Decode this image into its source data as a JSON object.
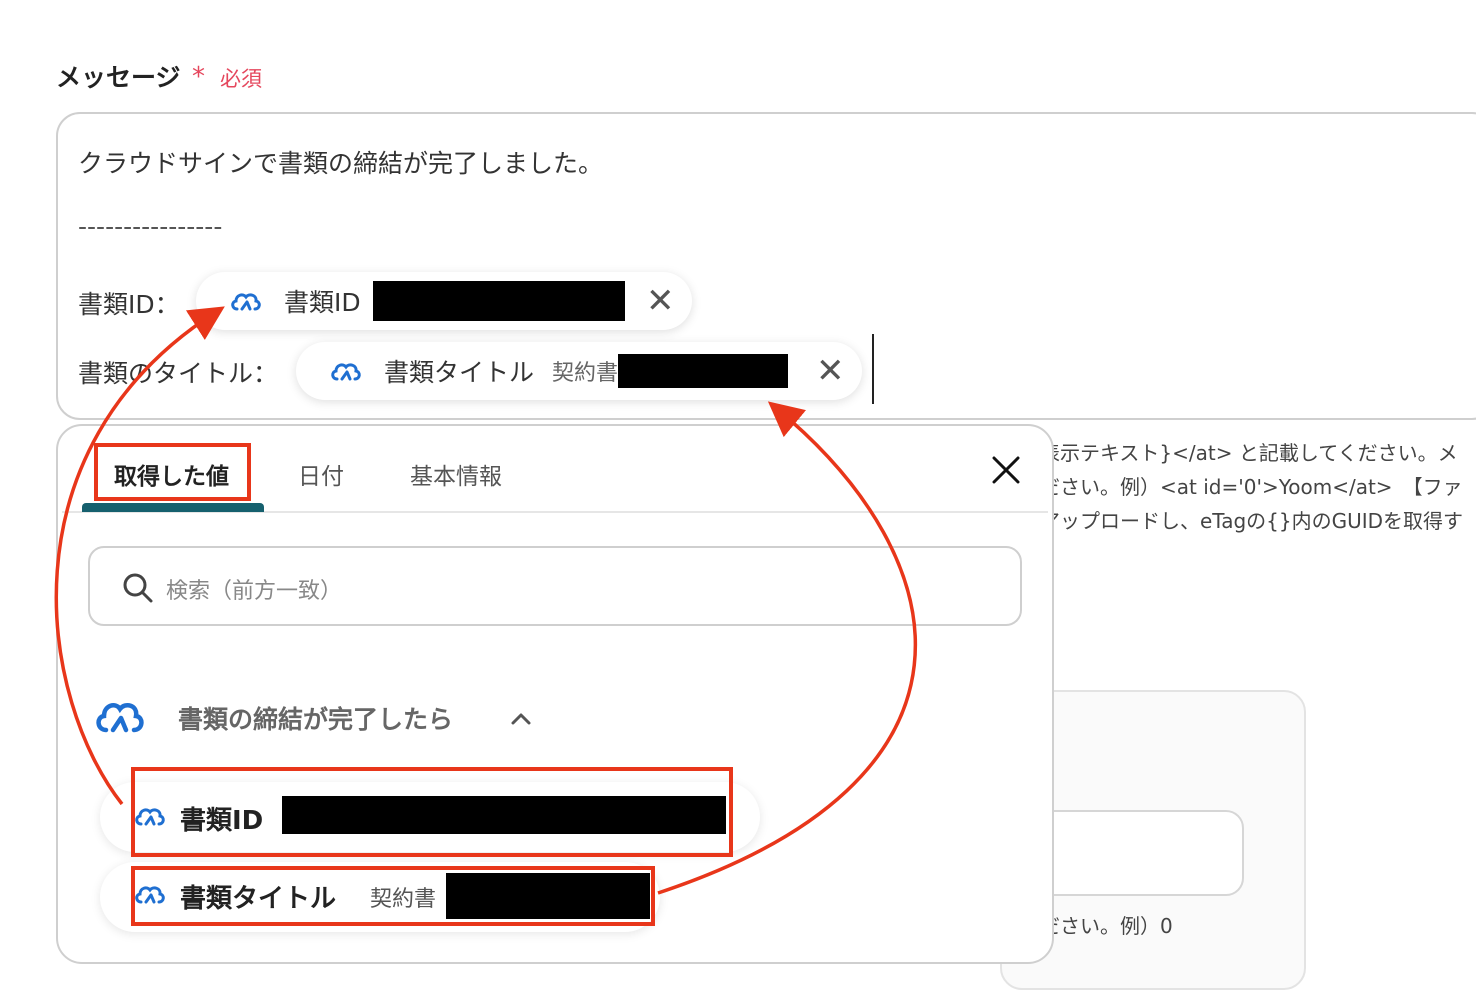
{
  "field": {
    "label": "メッセージ",
    "required_mark": "*",
    "required_text": "必須"
  },
  "message": {
    "line1": "クラウドサインで書類の締結が完了しました。",
    "divider": "----------------",
    "id_prefix": "書類ID：",
    "title_prefix": "書類のタイトル："
  },
  "chips": {
    "doc_id": {
      "label": "書類ID",
      "icon": "cloudsign-icon"
    },
    "doc_title": {
      "label": "書類タイトル",
      "value_prefix": "契約書"
    }
  },
  "help_text": {
    "line1": "表示テキスト}</at> と記載してください。メ",
    "line2": "ださい。例）<at id='0'>Yoom</at>　【ファ",
    "line3": "アップロードし、eTagの{}内のGUIDを取得す",
    "line4": "ださい。例）0"
  },
  "dropdown": {
    "tabs": [
      "取得した値",
      "日付",
      "基本情報"
    ],
    "active_tab": 0,
    "search_placeholder": "検索（前方一致）",
    "group_title": "書類の締結が完了したら",
    "items": [
      {
        "label": "書類ID",
        "value": ""
      },
      {
        "label": "書類タイトル",
        "value": "契約書"
      }
    ]
  },
  "colors": {
    "required": "#e5475d",
    "tab_underline": "#16606e",
    "icon_blue": "#1f6fd1",
    "highlight_red": "#e8361a"
  }
}
